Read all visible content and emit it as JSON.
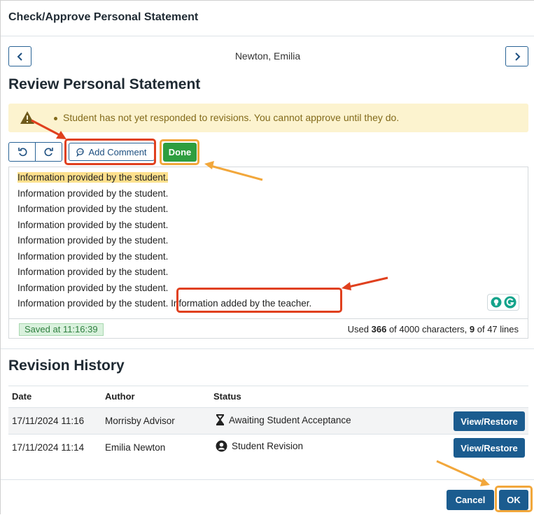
{
  "dialog": {
    "title": "Check/Approve Personal Statement"
  },
  "student": {
    "name": "Newton, Emilia"
  },
  "review": {
    "title": "Review Personal Statement",
    "alert": "Student has not yet responded to revisions. You cannot approve until they do.",
    "add_comment_label": "Add Comment",
    "done_label": "Done",
    "lines": [
      "Information provided by the student.",
      "Information provided by the student.",
      "Information provided by the student.",
      "Information provided by the student.",
      "Information provided by the student.",
      "Information provided by the student.",
      "Information provided by the student.",
      "Information provided by the student.",
      "Information provided by the student."
    ],
    "added_text": " Information added by the teacher.",
    "saved_status": "Saved at 11:16:39",
    "counter": {
      "used_prefix": "Used",
      "chars_used": "366",
      "chars_suffix": "of 4000 characters,",
      "lines_used": "9",
      "lines_suffix": "of 47 lines"
    }
  },
  "history": {
    "title": "Revision History",
    "columns": [
      "Date",
      "Author",
      "Status"
    ],
    "rows": [
      {
        "date": "17/11/2024 11:16",
        "author": "Morrisby Advisor",
        "status": "Awaiting Student Acceptance",
        "status_icon": "hourglass-icon",
        "action": "View/Restore"
      },
      {
        "date": "17/11/2024 11:14",
        "author": "Emilia Newton",
        "status": "Student Revision",
        "status_icon": "user-circle-icon",
        "action": "View/Restore"
      }
    ]
  },
  "footer": {
    "cancel_label": "Cancel",
    "ok_label": "OK"
  },
  "colors": {
    "primary": "#1b5c8f",
    "success": "#2e9e3f",
    "warning_bg": "#fcf3cf",
    "highlight": "#fde08d",
    "annotation_red": "#e0401e",
    "annotation_orange": "#f2a73b"
  }
}
